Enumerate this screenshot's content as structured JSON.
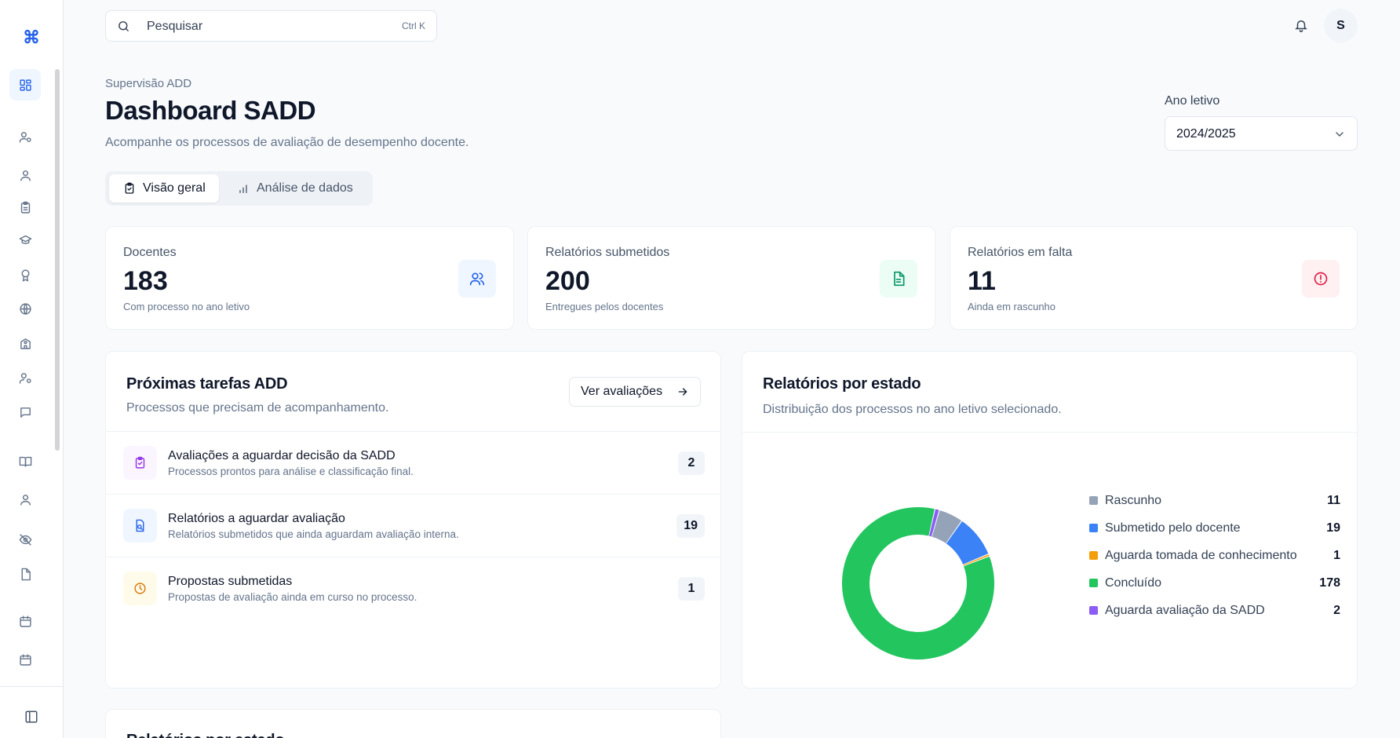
{
  "search": {
    "placeholder": "Pesquisar",
    "shortcut": "Ctrl K"
  },
  "user": {
    "initial": "S"
  },
  "header": {
    "eyebrow": "Supervisão ADD",
    "title": "Dashboard SADD",
    "subtitle": "Acompanhe os processos de avaliação de desempenho docente."
  },
  "year": {
    "label": "Ano letivo",
    "value": "2024/2025"
  },
  "tabs": [
    {
      "label": "Visão geral",
      "icon": "clipboard-check-icon",
      "active": true
    },
    {
      "label": "Análise de dados",
      "icon": "bar-chart-icon",
      "active": false
    }
  ],
  "stats": [
    {
      "label": "Docentes",
      "value": "183",
      "caption": "Com processo no ano letivo",
      "icon": "users-icon",
      "color": "#2563eb",
      "bg": "#eff6ff"
    },
    {
      "label": "Relatórios submetidos",
      "value": "200",
      "caption": "Entregues pelos docentes",
      "icon": "file-text-icon",
      "color": "#059669",
      "bg": "#ecfdf5"
    },
    {
      "label": "Relatórios em falta",
      "value": "11",
      "caption": "Ainda em rascunho",
      "icon": "alert-circle-icon",
      "color": "#e11d48",
      "bg": "#fff1f2"
    }
  ],
  "tasks_panel": {
    "title": "Próximas tarefas ADD",
    "subtitle": "Processos que precisam de acompanhamento.",
    "button": "Ver avaliações",
    "items": [
      {
        "title": "Avaliações a aguardar decisão da SADD",
        "subtitle": "Processos prontos para análise e classificação final.",
        "count": "2",
        "icon": "clipboard-check-icon",
        "color": "#9333ea",
        "bg": "#faf5ff"
      },
      {
        "title": "Relatórios a aguardar avaliação",
        "subtitle": "Relatórios submetidos que ainda aguardam avaliação interna.",
        "count": "19",
        "icon": "file-search-icon",
        "color": "#2563eb",
        "bg": "#eff6ff"
      },
      {
        "title": "Propostas submetidas",
        "subtitle": "Propostas de avaliação ainda em curso no processo.",
        "count": "1",
        "icon": "clock-icon",
        "color": "#d97706",
        "bg": "#fffbeb"
      }
    ]
  },
  "chart_panel": {
    "title": "Relatórios por estado",
    "subtitle": "Distribuição dos processos no ano letivo selecionado."
  },
  "chart_data": {
    "type": "pie",
    "donut": true,
    "categories": [
      "Rascunho",
      "Submetido pelo docente",
      "Aguarda tomada de conhecimento",
      "Concluído",
      "Aguarda avaliação da SADD"
    ],
    "values": [
      11,
      19,
      1,
      178,
      2
    ],
    "colors": [
      "#94a3b8",
      "#3b82f6",
      "#f59e0b",
      "#22c55e",
      "#8b5cf6"
    ],
    "legend": "right"
  },
  "bottom_panel": {
    "title": "Relatórios por estado"
  }
}
